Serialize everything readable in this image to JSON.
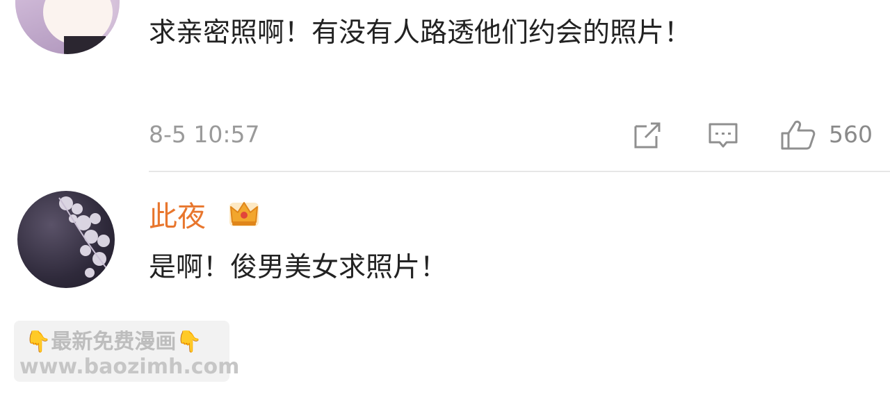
{
  "comments": [
    {
      "text": "求亲密照啊！有没有人路透他们约会的照片！",
      "time": "8-5 10:57",
      "like_count": "560"
    },
    {
      "username": "此夜",
      "text": "是啊！俊男美女求照片！"
    }
  ],
  "icons": {
    "share": "share-icon",
    "reply": "comment-icon",
    "like": "thumbs-up-icon",
    "badge": "crown-icon",
    "watermark_hand": "pointing-down-emoji"
  },
  "colors": {
    "username": "#e8762d",
    "timestamp": "#9a9a9a",
    "text": "#222222"
  },
  "watermark": {
    "line1": "👇最新免费漫画👇",
    "line2": "www.baozimh.com"
  }
}
